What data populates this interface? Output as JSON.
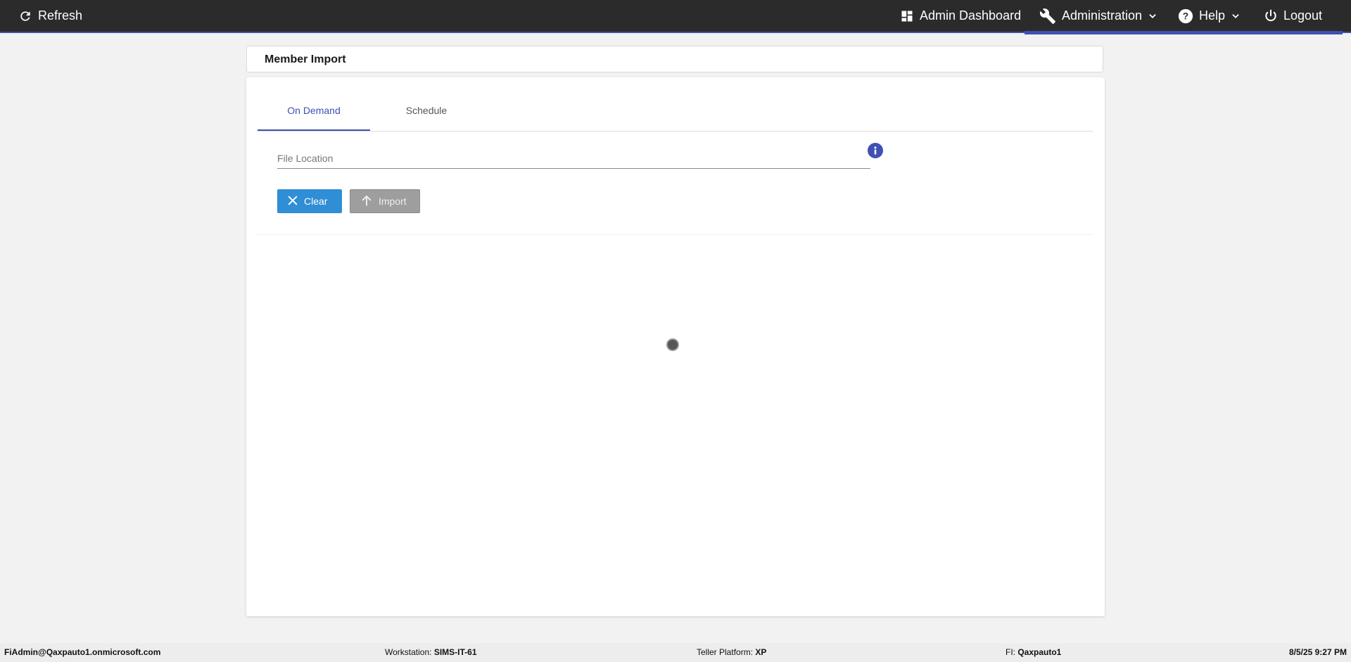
{
  "topbar": {
    "refresh_label": "Refresh",
    "admin_dashboard_label": "Admin Dashboard",
    "administration_label": "Administration",
    "help_label": "Help",
    "logout_label": "Logout",
    "accent_color": "#3f51b5",
    "bg_color": "#2b2b2b"
  },
  "page": {
    "title": "Member Import"
  },
  "tabs": [
    {
      "label": "On Demand",
      "active": true
    },
    {
      "label": "Schedule",
      "active": false
    }
  ],
  "form": {
    "file_location_placeholder": "File Location",
    "file_location_value": ""
  },
  "buttons": {
    "clear_label": "Clear",
    "import_label": "Import"
  },
  "footer": {
    "user": "FiAdmin@Qaxpauto1.onmicrosoft.com",
    "workstation_label": "Workstation:",
    "workstation_value": "SIMS-IT-61",
    "teller_platform_label": "Teller Platform:",
    "teller_platform_value": "XP",
    "fi_label": "FI:",
    "fi_value": "Qaxpauto1",
    "datetime": "8/5/25 9:27 PM"
  }
}
